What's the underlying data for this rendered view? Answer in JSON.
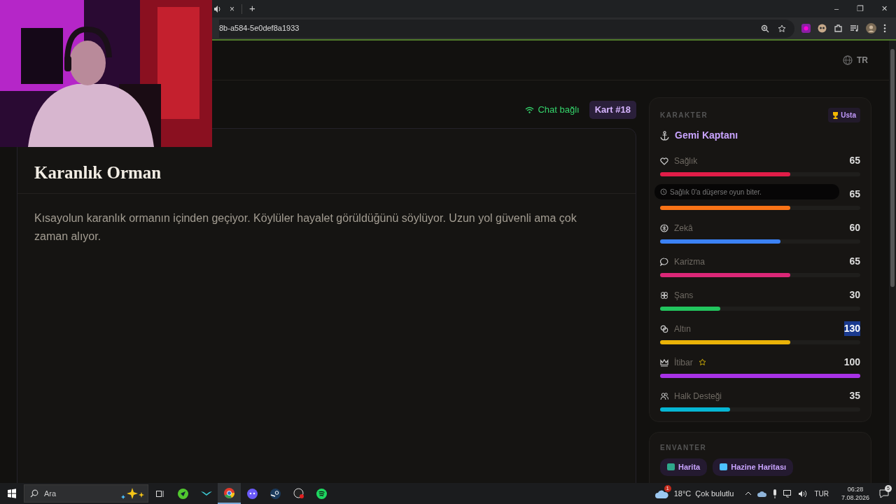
{
  "browser": {
    "tab_close": "×",
    "new_tab": "+",
    "url": "8b-a584-5e0def8a1933",
    "window_controls": [
      "–",
      "❐",
      "✕"
    ]
  },
  "header": {
    "language": "TR"
  },
  "status": {
    "chat": "Chat bağlı",
    "card_badge": "Kart #18"
  },
  "scene": {
    "title": "Karanlık Orman",
    "text": "Kısayolun karanlık ormanın içinden geçiyor. Köylüler hayalet görüldüğünü söylüyor. Uzun yol güvenli ama çok zaman alıyor."
  },
  "character": {
    "section": "KARAKTER",
    "rank": "Usta",
    "name": "Gemi Kaptanı",
    "stats": [
      {
        "name": "Sağlık",
        "value": "65",
        "level": 0.65,
        "color": "#e11d48",
        "text_selected": false
      },
      {
        "value": "65",
        "level": 0.65,
        "color": "#f97316",
        "text_selected": false
      },
      {
        "name": "Zekâ",
        "value": "60",
        "level": 0.6,
        "color": "#3b82f6",
        "text_selected": false
      },
      {
        "name": "Karizma",
        "value": "65",
        "level": 0.65,
        "color": "#db2777",
        "text_selected": false
      },
      {
        "name": "Şans",
        "value": "30",
        "level": 0.3,
        "color": "#22c55e",
        "text_selected": false
      },
      {
        "name": "Altın",
        "value": "130",
        "level": 0.65,
        "color": "#eab308",
        "text_selected": true
      },
      {
        "name": "İtibar",
        "value": "100",
        "level": 1,
        "color": "#a832e6",
        "text_selected": false,
        "starred": true
      },
      {
        "name": "Halk Desteği",
        "value": "35",
        "level": 0.35,
        "color": "#06b6d4",
        "text_selected": false
      }
    ],
    "tooltip": "Sağlık 0'a düşerse oyun biter."
  },
  "inventory": {
    "section": "ENVANTER",
    "items": [
      "Harita",
      "Hazine Haritası"
    ]
  },
  "taskbar": {
    "search": "Ara",
    "weather": "18°C  Çok bulutlu",
    "weather_badge": "1",
    "language": "TUR",
    "time": "06:28",
    "date": "7.08.2026",
    "notifications": "5"
  }
}
